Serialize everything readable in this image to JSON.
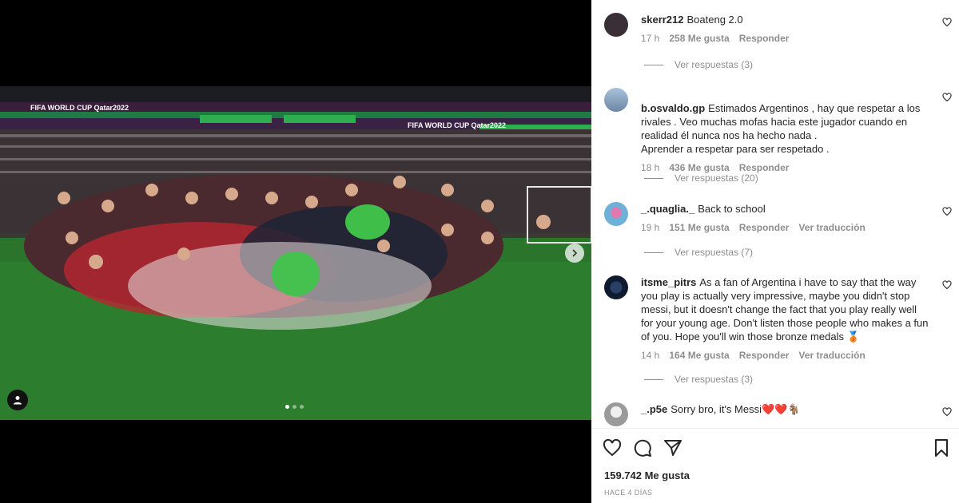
{
  "post": {
    "banner_text": "FIFA WORLD CUP Qatar2022",
    "carousel": {
      "count": 3,
      "active": 1
    }
  },
  "comments": [
    {
      "username": "skerr212",
      "text": "Boateng 2.0",
      "time": "17 h",
      "likes": "258 Me gusta",
      "reply": "Responder",
      "translate": "",
      "view_replies": "Ver respuestas (3)",
      "avatar_color": "#3a2f36"
    },
    {
      "username": "b.osvaldo.gp",
      "text": "Estimados Argentinos , hay que respetar a los rivales . Veo muchas mofas hacia este jugador cuando en realidad él nunca nos ha hecho nada .\nAprender a respetar para ser respetado .",
      "time": "18 h",
      "likes": "436 Me gusta",
      "reply": "Responder",
      "translate": "",
      "view_replies": "Ver respuestas (20)",
      "avatar_color": "#8aa0b8"
    },
    {
      "username": "_.quaglia._",
      "text": "Back to school",
      "time": "19 h",
      "likes": "151 Me gusta",
      "reply": "Responder",
      "translate": "Ver traducción",
      "view_replies": "Ver respuestas (7)",
      "avatar_color": "#6fb0d8"
    },
    {
      "username": "itsme_pitrs",
      "text": "As a fan of Argentina i have to say that the way you play is actually very impressive, maybe you didn't stop messi, but it doesn't change the fact that you play really well for your young age. Don't listen those people who makes a fun of you. Hope you'll win those bronze medals 🥉",
      "time": "14 h",
      "likes": "164 Me gusta",
      "reply": "Responder",
      "translate": "Ver traducción",
      "view_replies": "Ver respuestas (3)",
      "avatar_color": "#0e1a2e"
    },
    {
      "username": "_.p5e",
      "text": "Sorry bro, it's Messi❤️❤️🐐",
      "time": "",
      "likes": "",
      "reply": "",
      "translate": "",
      "view_replies": "",
      "avatar_color": "#9a9a9a"
    }
  ],
  "footer": {
    "likes": "159.742 Me gusta",
    "ago": "HACE 4 DÍAS"
  },
  "icons": {
    "like": "heart-icon",
    "comment": "comment-icon",
    "share": "share-icon",
    "save": "bookmark-icon",
    "tag": "user-tag-icon",
    "next": "chevron-right-icon"
  }
}
